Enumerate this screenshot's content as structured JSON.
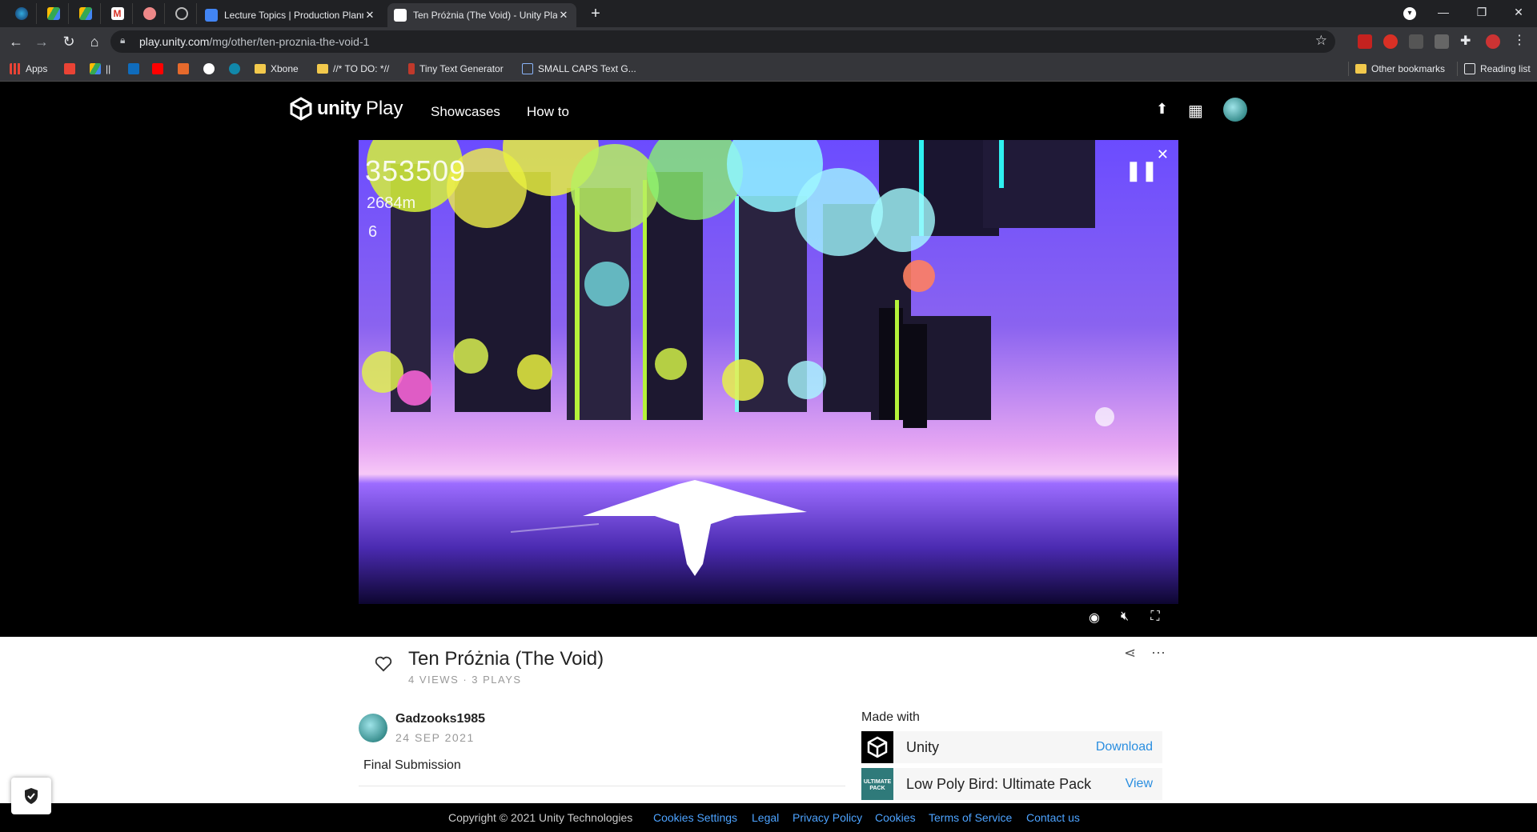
{
  "browser": {
    "tabs": [
      {
        "title": "Lecture Topics | Production Plann",
        "icon": "google-docs-icon",
        "active": false
      },
      {
        "title": "Ten Próżnia (The Void) - Unity Pla",
        "icon": "unity-icon",
        "active": true
      }
    ],
    "url_domain": "play.unity.com",
    "url_path": "/mg/other/ten-proznia-the-void-1",
    "bookmarks": [
      {
        "label": "Apps",
        "icon": "apps-grid-icon"
      },
      {
        "label": "||",
        "icon": "google-drive-icon"
      },
      {
        "label": "Xbone",
        "icon": "folder-icon"
      },
      {
        "label": "//* TO DO: *//",
        "icon": "folder-icon"
      },
      {
        "label": "Tiny Text Generator",
        "icon": "bookmark-icon"
      },
      {
        "label": "SMALL CAPS Text G...",
        "icon": "bookmark-icon"
      }
    ],
    "other_bookmarks": "Other bookmarks",
    "reading_list": "Reading list"
  },
  "header": {
    "brand": "unity",
    "brand_suffix": "Play",
    "nav": [
      "Showcases",
      "How to"
    ]
  },
  "game": {
    "score": "353509",
    "distance": "2684m",
    "lives": "6"
  },
  "details": {
    "title": "Ten Próżnia (The Void)",
    "stats": "4 VIEWS · 3 PLAYS",
    "author": "Gadzooks1985",
    "date": "24 SEP 2021",
    "description": "Final Submission"
  },
  "made_with": {
    "heading": "Made with",
    "items": [
      {
        "name": "Unity",
        "action": "Download"
      },
      {
        "name": "Low Poly Bird: Ultimate Pack",
        "action": "View",
        "thumb_text": "ULTIMATE PACK"
      }
    ]
  },
  "footer": {
    "copyright": "Copyright © 2021 Unity Technologies",
    "links": [
      "Cookies Settings",
      "Legal",
      "Privacy Policy",
      "Cookies",
      "Terms of Service",
      "Contact us"
    ]
  },
  "colors": {
    "link": "#4da3ff",
    "accent": "#2a8ee0"
  }
}
